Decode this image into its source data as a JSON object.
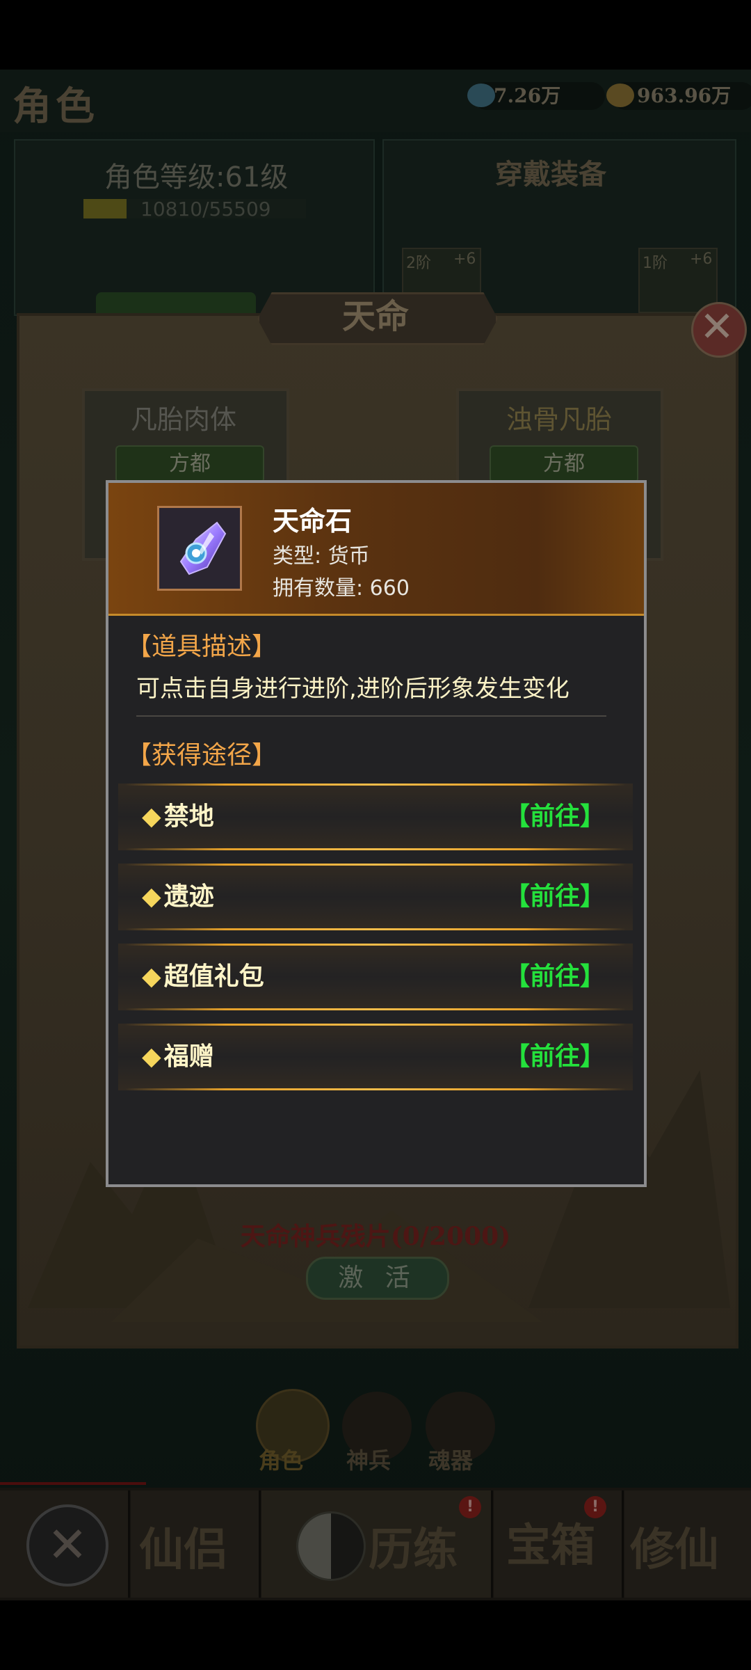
{
  "background": {
    "role_title": "角色",
    "currencies": {
      "gem": {
        "icon": "diamond-icon",
        "value": "7.26万"
      },
      "gold": {
        "icon": "gold-ingot-icon",
        "value": "963.96万"
      }
    },
    "level_label": "角色等级:61级",
    "xp_text": "10810/55509",
    "xp_progress": 0.195,
    "equipped_title": "穿戴装备",
    "equip_slots": [
      {
        "tier": "2阶",
        "plus": "+6"
      },
      {
        "tier": "1阶",
        "plus": "+6"
      }
    ],
    "dialog_title": "天命",
    "cards": [
      {
        "name": "凡胎肉体",
        "tab": "方都"
      },
      {
        "name": "浊骨凡胎",
        "tab": "方都"
      }
    ],
    "shards_text": "天命神兵残片(0/2000)",
    "activate_label": "激 活",
    "sub_tabs": [
      "角色",
      "神兵",
      "魂器"
    ],
    "nav": {
      "xianlv": "仙侣",
      "lilian": "历练",
      "box": "宝箱",
      "xiuxian": "修仙",
      "badge": "!"
    }
  },
  "popup": {
    "item_name": "天命石",
    "type_row": "类型: 货币",
    "count_row": "拥有数量: 660",
    "desc_title": "【道具描述】",
    "desc_text": "可点击自身进行进阶,进阶后形象发生变化",
    "source_title": "【获得途径】",
    "sources": [
      {
        "name": "禁地",
        "go": "【前往】"
      },
      {
        "name": "遗迹",
        "go": "【前往】"
      },
      {
        "name": "超值礼包",
        "go": "【前往】"
      },
      {
        "name": "福赠",
        "go": "【前往】"
      }
    ],
    "diamond": "◆"
  },
  "colors": {
    "accent_orange": "#f3a649",
    "go_green": "#24e13c",
    "row_gold": "#e6a12a"
  }
}
